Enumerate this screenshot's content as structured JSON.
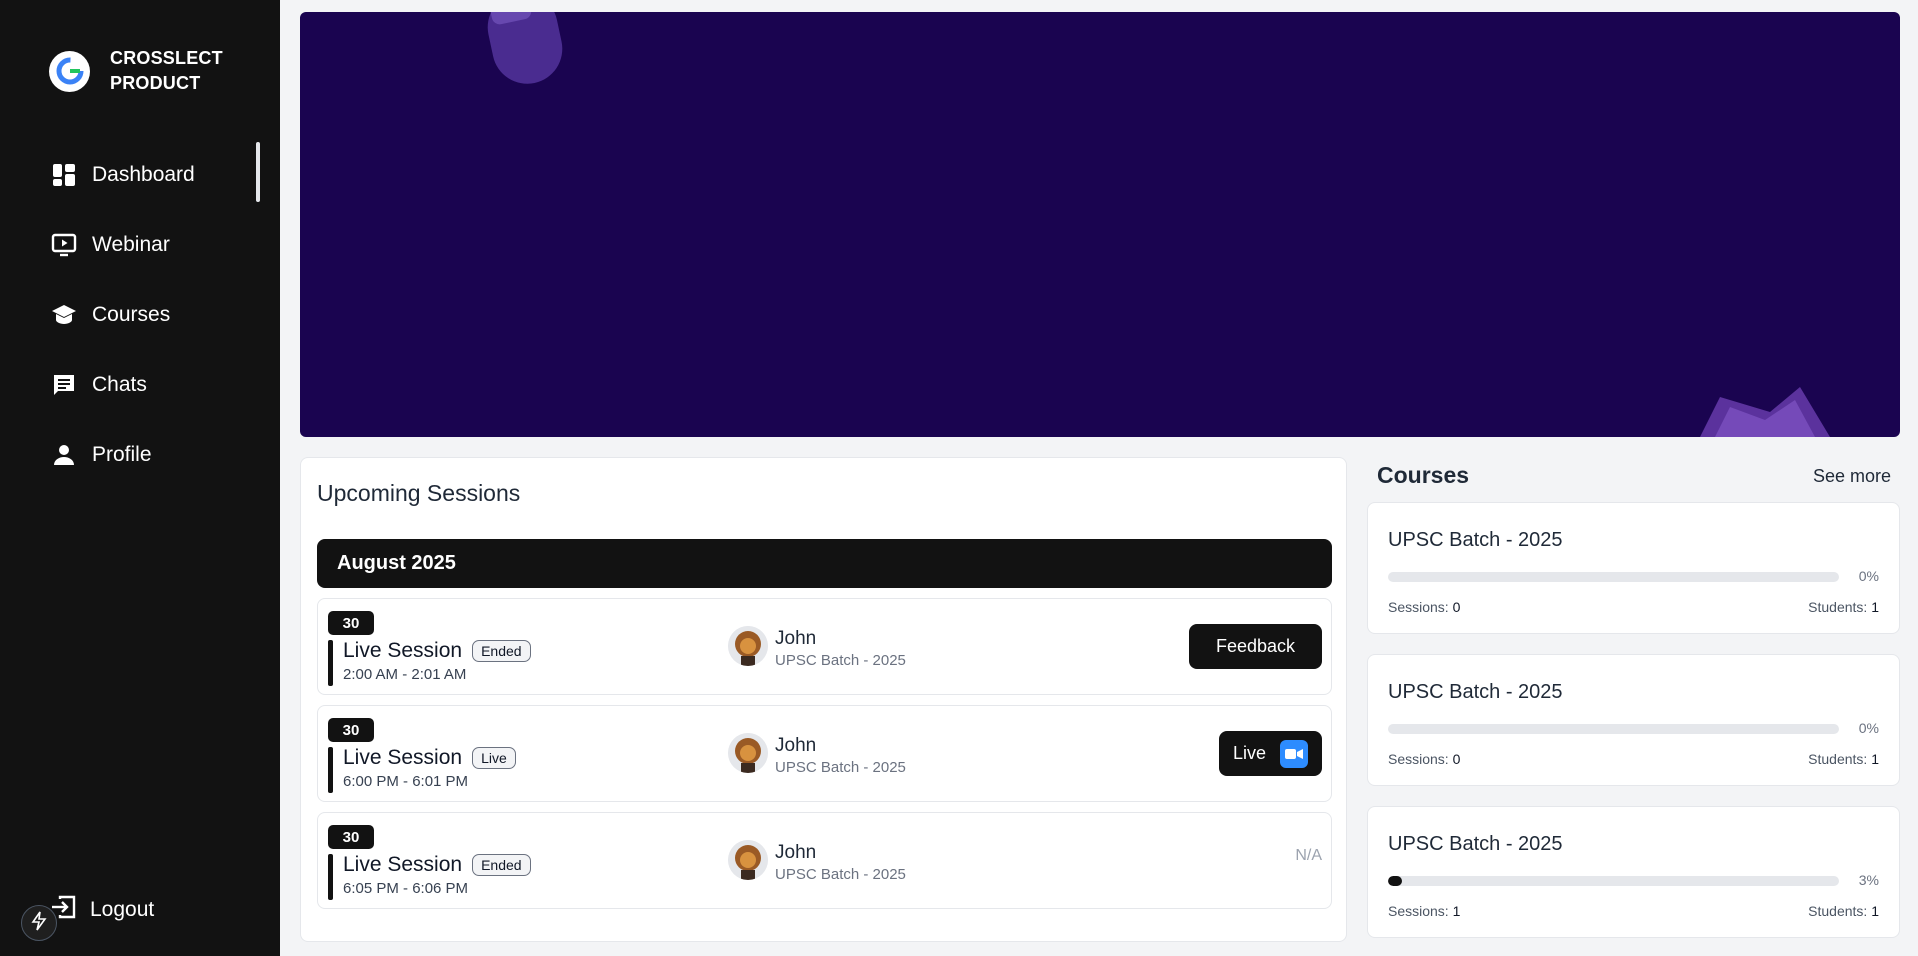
{
  "brand": {
    "name": "CROSSLECT PRODUCT"
  },
  "sidebar": {
    "items": [
      {
        "label": "Dashboard",
        "icon": "dashboard-icon",
        "active": true
      },
      {
        "label": "Webinar",
        "icon": "webinar-icon"
      },
      {
        "label": "Courses",
        "icon": "courses-icon"
      },
      {
        "label": "Chats",
        "icon": "chat-icon"
      },
      {
        "label": "Profile",
        "icon": "profile-icon"
      }
    ],
    "logout_label": "Logout"
  },
  "colors": {
    "sidebar_bg": "#121212",
    "banner_bg": "#1a0450",
    "zoom_blue": "#2d8cff"
  },
  "sessions": {
    "title": "Upcoming Sessions",
    "month": "August 2025",
    "rows": [
      {
        "day": "30",
        "name": "Live Session",
        "status": "Ended",
        "time": "2:00 AM - 2:01 AM",
        "host": "John",
        "course": "UPSC Batch - 2025",
        "action": "Feedback"
      },
      {
        "day": "30",
        "name": "Live Session",
        "status": "Live",
        "time": "6:00 PM - 6:01 PM",
        "host": "John",
        "course": "UPSC Batch - 2025",
        "action": "Live"
      },
      {
        "day": "30",
        "name": "Live Session",
        "status": "Ended",
        "time": "6:05 PM - 6:06 PM",
        "host": "John",
        "course": "UPSC Batch - 2025",
        "action": "N/A"
      }
    ]
  },
  "courses": {
    "title": "Courses",
    "see_more": "See more",
    "sessions_label": "Sessions:",
    "students_label": "Students:",
    "items": [
      {
        "name": "UPSC Batch - 2025",
        "progress_percent": 0,
        "progress_label": "0%",
        "sessions": "0",
        "students": "1"
      },
      {
        "name": "UPSC Batch - 2025",
        "progress_percent": 0,
        "progress_label": "0%",
        "sessions": "0",
        "students": "1"
      },
      {
        "name": "UPSC Batch - 2025",
        "progress_percent": 3,
        "progress_label": "3%",
        "sessions": "1",
        "students": "1"
      }
    ]
  }
}
